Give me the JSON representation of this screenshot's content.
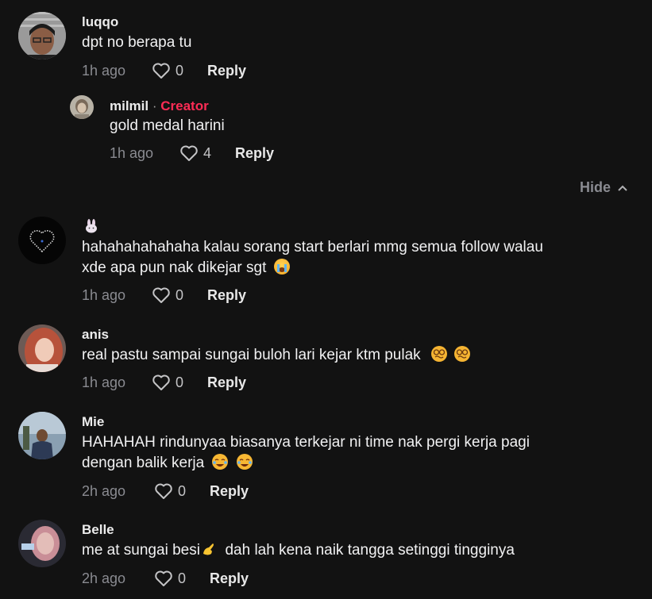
{
  "comments": [
    {
      "username": "luqqo",
      "text": "dpt no berapa tu",
      "time": "1h ago",
      "likes": "0",
      "reply_label": "Reply"
    },
    {
      "username": "milmil",
      "separator": " · ",
      "badge": "Creator",
      "text": "gold medal harini",
      "time": "1h ago",
      "likes": "4",
      "reply_label": "Reply"
    },
    {
      "username": "",
      "text_line1": "hahahahahahaha kalau sorang start berlari mmg semua follow walau",
      "text_line2": "xde apa pun nak dikejar sgt",
      "time": "1h ago",
      "likes": "0",
      "reply_label": "Reply"
    },
    {
      "username": "anis",
      "text": "real pastu sampai sungai buloh lari kejar ktm pulak",
      "time": "1h ago",
      "likes": "0",
      "reply_label": "Reply"
    },
    {
      "username": "Mie",
      "text_line1": "HAHAHAH rindunyaa biasanya terkejar ni time nak pergi kerja pagi",
      "text_line2": "dengan balik kerja",
      "time": "2h ago",
      "likes": "0",
      "reply_label": "Reply"
    },
    {
      "username": "Belle",
      "text_part1": "me at sungai besi",
      "text_part2": "  dah lah kena naik tangga setinggi tingginya",
      "time": "2h ago",
      "likes": "0",
      "reply_label": "Reply"
    }
  ],
  "hide_label": "Hide",
  "icons": {
    "like": "heart-outline-icon",
    "hide": "chevron-up-icon"
  },
  "colors": {
    "background": "#121212",
    "creator_badge": "#fe2c55",
    "secondary_text": "#8a8b91"
  }
}
